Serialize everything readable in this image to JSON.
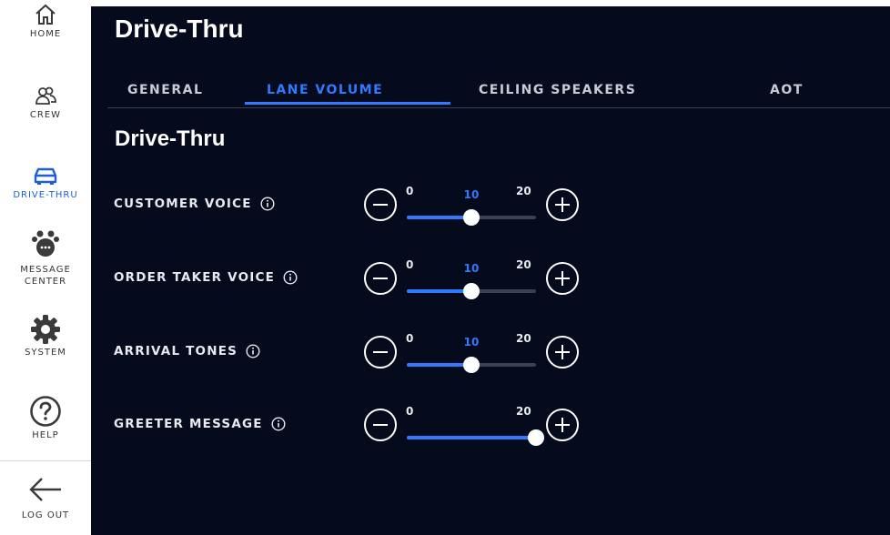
{
  "sidebar": {
    "items": [
      {
        "id": "home",
        "label": "HOME",
        "icon": "home-icon",
        "active": false
      },
      {
        "id": "crew",
        "label": "CREW",
        "icon": "crew-icon",
        "active": false
      },
      {
        "id": "drive-thru",
        "label": "DRIVE-THRU",
        "icon": "car-icon",
        "active": true
      },
      {
        "id": "message-center",
        "label": "MESSAGE\nCENTER",
        "label_line1": "MESSAGE",
        "label_line2": "CENTER",
        "icon": "message-center-icon",
        "active": false
      },
      {
        "id": "system",
        "label": "SYSTEM",
        "icon": "gear-icon",
        "active": false
      },
      {
        "id": "help",
        "label": "HELP",
        "icon": "help-icon",
        "active": false
      }
    ],
    "logout": {
      "label": "LOG OUT",
      "icon": "arrow-left-icon"
    }
  },
  "header": {
    "title": "Drive-Thru"
  },
  "tabs": [
    {
      "label": "GENERAL",
      "active": false
    },
    {
      "label": "LANE VOLUME",
      "active": true
    },
    {
      "label": "CEILING SPEAKERS",
      "active": false
    },
    {
      "label": "AOT",
      "active": false
    }
  ],
  "section": {
    "title": "Drive-Thru"
  },
  "controls": [
    {
      "label": "CUSTOMER VOICE",
      "min": "0",
      "max": "20",
      "value": "10",
      "show_value": true
    },
    {
      "label": "ORDER TAKER VOICE",
      "min": "0",
      "max": "20",
      "value": "10",
      "show_value": true
    },
    {
      "label": "ARRIVAL TONES",
      "min": "0",
      "max": "20",
      "value": "10",
      "show_value": true
    },
    {
      "label": "GREETER MESSAGE",
      "min": "0",
      "max": "20",
      "value": "20",
      "show_value": false
    }
  ],
  "colors": {
    "accent": "#2f7bff",
    "panel_bg": "#050a1c",
    "sidebar_bg": "#ffffff",
    "active_nav": "#1f5fd6"
  }
}
